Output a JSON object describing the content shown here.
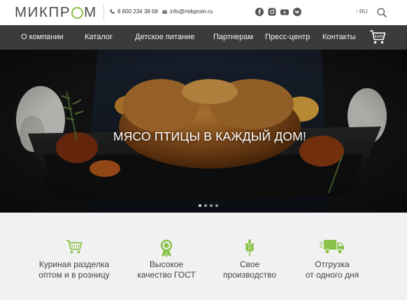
{
  "header": {
    "logo": {
      "part1": "МИКПР",
      "part2": "М",
      "accent_color": "#8bc34a"
    },
    "phone": "8 800 234 38 68",
    "email": "info@mikprom.ru",
    "socials": [
      "facebook-icon",
      "instagram-icon",
      "youtube-icon",
      "vk-icon"
    ],
    "language": "RU"
  },
  "nav": {
    "items": [
      {
        "label": "О компании"
      },
      {
        "label": "Каталог"
      },
      {
        "label": "Детское питание"
      },
      {
        "label": "Партнерам"
      },
      {
        "label": "Пресс-центр"
      },
      {
        "label": "Контакты"
      }
    ],
    "background": "#3b3b3b"
  },
  "hero": {
    "title": "МЯСО ПТИЦЫ В КАЖДЫЙ ДОМ!",
    "slides": 4,
    "active_slide": 1
  },
  "features": {
    "accent_color": "#8bc34a",
    "items": [
      {
        "icon": "cart-icon",
        "line1": "Куриная разделка",
        "line2": "оптом и в розницу"
      },
      {
        "icon": "award-icon",
        "line1": "Высокое",
        "line2": "качество ГОСТ"
      },
      {
        "icon": "wheat-icon",
        "line1": "Свое",
        "line2": "производство"
      },
      {
        "icon": "truck-icon",
        "line1": "Отгрузка",
        "line2": "от одного дня"
      }
    ]
  }
}
